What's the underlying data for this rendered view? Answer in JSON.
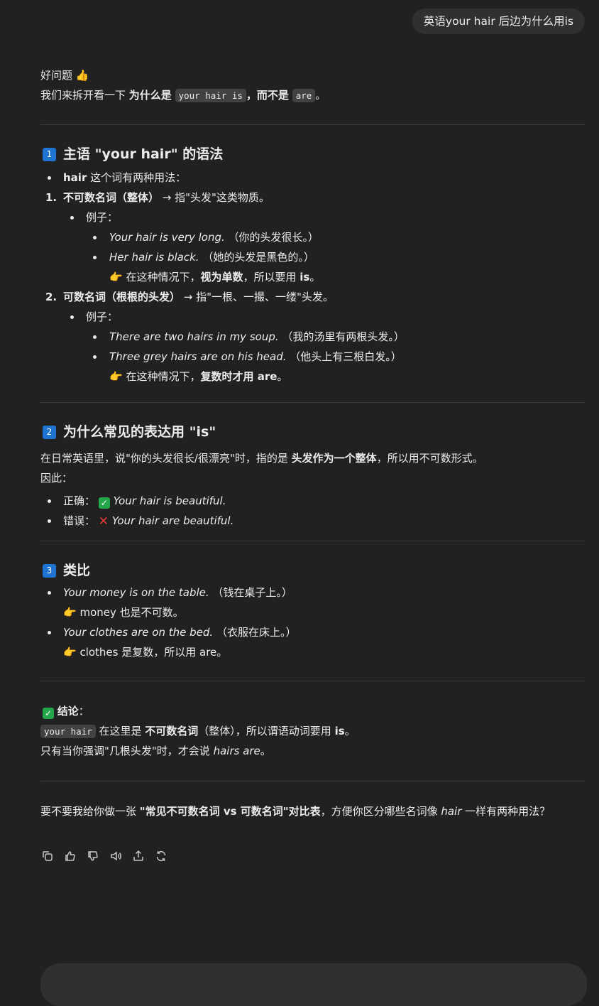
{
  "user_message": "英语your hair 后边为什么用is",
  "intro": {
    "line1": "好问题 ",
    "thumbs": "👍",
    "line2_a": "我们来拆开看一下 ",
    "line2_b": "为什么是",
    "line2_code": "your hair is",
    "line2_c": "，而不是",
    "line2_code2": "are",
    "line2_d": "。"
  },
  "section1": {
    "num": "1",
    "title": "主语 \"your hair\" 的语法",
    "bullet_b": "hair",
    "bullet_t": " 这个词有两种用法：",
    "item1_num": "1.",
    "item1_b": "不可数名词（整体）",
    "item1_t": " → 指\"头发\"这类物质。",
    "item1_ex": "例子：",
    "item1_ex1_i": "Your hair is very long.",
    "item1_ex1_t": " （你的头发很长。）",
    "item1_ex2_i": "Her hair is black.",
    "item1_ex2_t": " （她的头发是黑色的。）",
    "item1_note_a": " 在这种情况下，",
    "item1_note_b": "视为单数",
    "item1_note_c": "，所以要用 ",
    "item1_note_d": "is",
    "item1_note_e": "。",
    "item2_num": "2.",
    "item2_b": "可数名词（根根的头发）",
    "item2_t": " → 指\"一根、一撮、一缕\"头发。",
    "item2_ex": "例子：",
    "item2_ex1_i": "There are two hairs in my soup.",
    "item2_ex1_t": " （我的汤里有两根头发。）",
    "item2_ex2_i": "Three grey hairs are on his head.",
    "item2_ex2_t": " （他头上有三根白发。）",
    "item2_note_a": " 在这种情况下，",
    "item2_note_b": "复数时才用 are",
    "item2_note_c": "。"
  },
  "section2": {
    "num": "2",
    "title": "为什么常见的表达用 \"is\"",
    "p1_a": "在日常英语里，说\"你的头发很长/很漂亮\"时，指的是 ",
    "p1_b": "头发作为一个整体",
    "p1_c": "，所以用不可数形式。",
    "p2": "因此：",
    "ok_label": "正确：",
    "ok_check": "✓",
    "ok_text": "Your hair is beautiful.",
    "bad_label": "错误：",
    "bad_cross": "✕",
    "bad_text": "Your hair are beautiful."
  },
  "section3": {
    "num": "3",
    "title": "类比",
    "ex1_i": "Your money is on the table.",
    "ex1_t": " （钱在桌子上。）",
    "ex1_note": " money 也是不可数。",
    "ex2_i": "Your clothes are on the bed.",
    "ex2_t": " （衣服在床上。）",
    "ex2_note": " clothes 是复数，所以用 are。"
  },
  "conclusion": {
    "check": "✓",
    "title": "结论",
    "colon": "：",
    "code": "your hair",
    "l1_a": " 在这里是 ",
    "l1_b": "不可数名词",
    "l1_c": "（整体），所以谓语动词要用 ",
    "l1_d": "is",
    "l1_e": "。",
    "l2_a": "只有当你强调\"几根头发\"时，才会说 ",
    "l2_i": "hairs are",
    "l2_b": "。"
  },
  "followup": {
    "a": "要不要我给你做一张 ",
    "b": "\"常见不可数名词 vs 可数名词\"对比表",
    "c": "，方便你区分哪些名词像 ",
    "d": "hair",
    "e": " 一样有两种用法？"
  },
  "hand_emoji": "👉"
}
